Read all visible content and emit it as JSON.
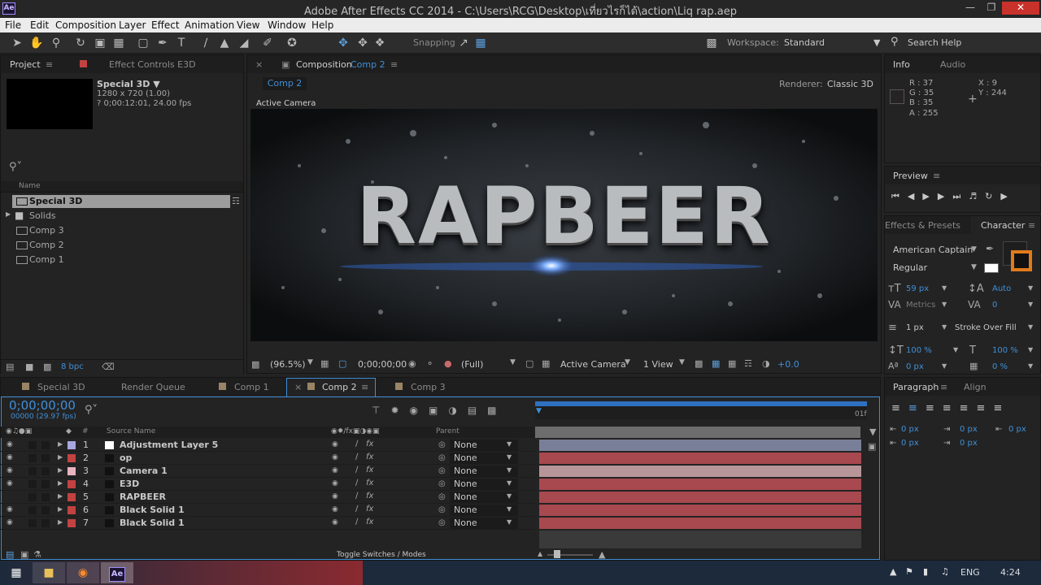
{
  "window": {
    "title": "Adobe After Effects CC 2014 - C:\\Users\\RCG\\Desktop\\เที่ยวไรก็ได้\\action\\Liq rap.aep",
    "logo": "Ae"
  },
  "menu": [
    "File",
    "Edit",
    "Composition",
    "Layer",
    "Effect",
    "Animation",
    "View",
    "Window",
    "Help"
  ],
  "toolbar": {
    "snapping": "Snapping",
    "workspace_label": "Workspace:",
    "workspace_value": "Standard",
    "search_help": "Search Help"
  },
  "project": {
    "tab_project": "Project",
    "tab_effect_controls": "Effect Controls E3D",
    "item_name": "Special 3D",
    "item_size": "1280 x 720 (1.00)",
    "item_duration": "? 0;00:12:01, 24.00 fps",
    "column_name": "Name",
    "items": [
      {
        "name": "Special 3D",
        "type": "comp"
      },
      {
        "name": "Solids",
        "type": "folder"
      },
      {
        "name": "Comp 3",
        "type": "comp"
      },
      {
        "name": "Comp 2",
        "type": "comp"
      },
      {
        "name": "Comp 1",
        "type": "comp"
      }
    ],
    "bpc": "8 bpc"
  },
  "composition": {
    "tab_label": "Composition",
    "tab_comp": "Comp 2",
    "comp_button": "Comp 2",
    "renderer_label": "Renderer:",
    "renderer_value": "Classic 3D",
    "active_camera_label": "Active Camera",
    "viewer_text": "RAPBEER",
    "zoom": "(96.5%)",
    "timecode": "0;00;00;00",
    "resolution": "(Full)",
    "view_camera": "Active Camera",
    "view_count": "1 View",
    "exposure": "+0.0"
  },
  "info": {
    "tab_info": "Info",
    "tab_audio": "Audio",
    "r": "R : 37",
    "g": "G : 35",
    "b": "B : 35",
    "a": "A : 255",
    "x": "X : 9",
    "y": "Y : 244"
  },
  "preview": {
    "title": "Preview"
  },
  "character": {
    "tab_effects": "Effects & Presets",
    "tab_character": "Character",
    "font": "American Captain",
    "style": "Regular",
    "size": "59 px",
    "leading": "Auto",
    "kerning": "Metrics",
    "tracking": "0",
    "stroke_width": "1 px",
    "stroke_mode": "Stroke Over Fill",
    "vscale": "100 %",
    "hscale": "100 %",
    "baseline": "0 px",
    "tsume": "0 %"
  },
  "paragraph": {
    "tab_paragraph": "Paragraph",
    "tab_align": "Align",
    "indent_left": "0 px",
    "indent_right": "0 px",
    "indent_first": "0 px",
    "space_before": "0 px",
    "space_after": "0 px"
  },
  "timeline": {
    "tabs": [
      "Special 3D",
      "Render Queue",
      "Comp 1",
      "Comp 2",
      "Comp 3"
    ],
    "active_tab": "Comp 2",
    "timecode": "0;00;00;00",
    "fps": "00000 (29.97 fps)",
    "col_num": "#",
    "col_source": "Source Name",
    "col_parent": "Parent",
    "end_label": "01f",
    "toggle_label": "Toggle Switches / Modes",
    "layers": [
      {
        "num": "1",
        "name": "Adjustment Layer 5",
        "label": "#a7a7e0",
        "parent": "None",
        "bar": "#7a7f99"
      },
      {
        "num": "2",
        "name": "op",
        "label": "#c24242",
        "parent": "None",
        "bar": "#a8494f"
      },
      {
        "num": "3",
        "name": "Camera 1",
        "label": "#e8b4c0",
        "parent": "None",
        "bar": "#b89599"
      },
      {
        "num": "4",
        "name": "E3D",
        "label": "#c24242",
        "parent": "None",
        "bar": "#a8494f"
      },
      {
        "num": "5",
        "name": "RAPBEER",
        "label": "#c24242",
        "parent": "None",
        "bar": "#a8494f"
      },
      {
        "num": "6",
        "name": "Black Solid 1",
        "label": "#c24242",
        "parent": "None",
        "bar": "#a8494f"
      },
      {
        "num": "7",
        "name": "Black Solid 1",
        "label": "#c24242",
        "parent": "None",
        "bar": "#a8494f"
      }
    ]
  },
  "taskbar": {
    "lang": "ENG",
    "time": "4:24"
  }
}
